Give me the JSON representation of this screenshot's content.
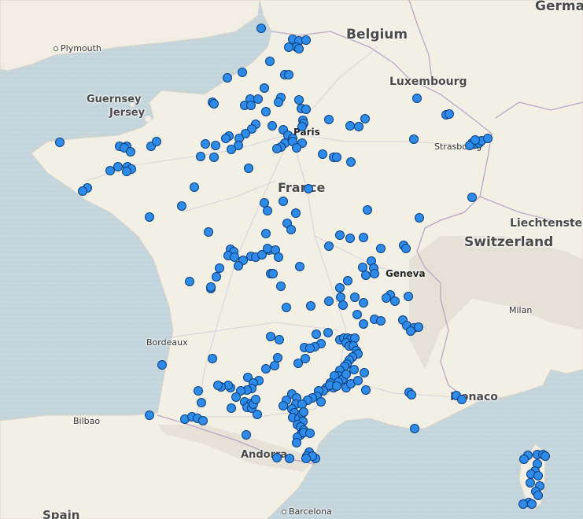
{
  "map": {
    "labels": {
      "german": "German",
      "belgium": "Belgium",
      "luxembourg": "Luxembourg",
      "plymouth": "Plymouth",
      "guernsey": "Guernsey",
      "jersey": "Jersey",
      "paris": "Paris",
      "france": "France",
      "strasbourg": "Strasbourg",
      "liechtenstein": "Liechtenstein",
      "switzerland": "Switzerland",
      "geneva": "Geneva",
      "milan": "Milan",
      "bordeaux": "Bordeaux",
      "monaco": "Monaco",
      "bilbao": "Bilbao",
      "andorra": "Andorra",
      "barcelona": "Barcelona",
      "spain": "Spain"
    },
    "marker_color": "#2f8bea",
    "marker_stroke": "#0a3f7a",
    "land_color": "#f2efe6",
    "sea_color": "#c9d8de"
  }
}
